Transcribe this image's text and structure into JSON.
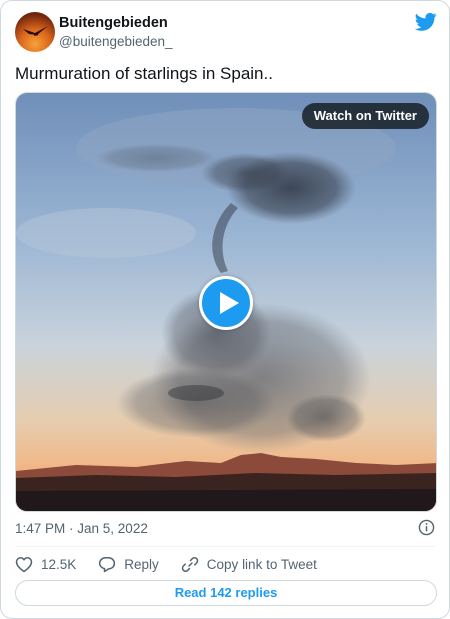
{
  "author": {
    "name": "Buitengebieden",
    "handle": "@buitengebieden_"
  },
  "tweet": {
    "text": "Murmuration of starlings in Spain..",
    "timestamp": "1:47 PM · Jan 5, 2022"
  },
  "media": {
    "watch_label": "Watch on Twitter",
    "icon": "play-icon"
  },
  "actions": {
    "likes": "12.5K",
    "reply_label": "Reply",
    "copy_link_label": "Copy link to Tweet"
  },
  "read_replies_label": "Read 142 replies",
  "colors": {
    "accent": "#1d9bf0",
    "text_primary": "#0f1419",
    "text_secondary": "#536471",
    "border": "#cfd9de"
  },
  "icons": [
    "twitter-logo-icon",
    "info-icon",
    "heart-icon",
    "reply-icon",
    "link-icon",
    "play-icon"
  ]
}
